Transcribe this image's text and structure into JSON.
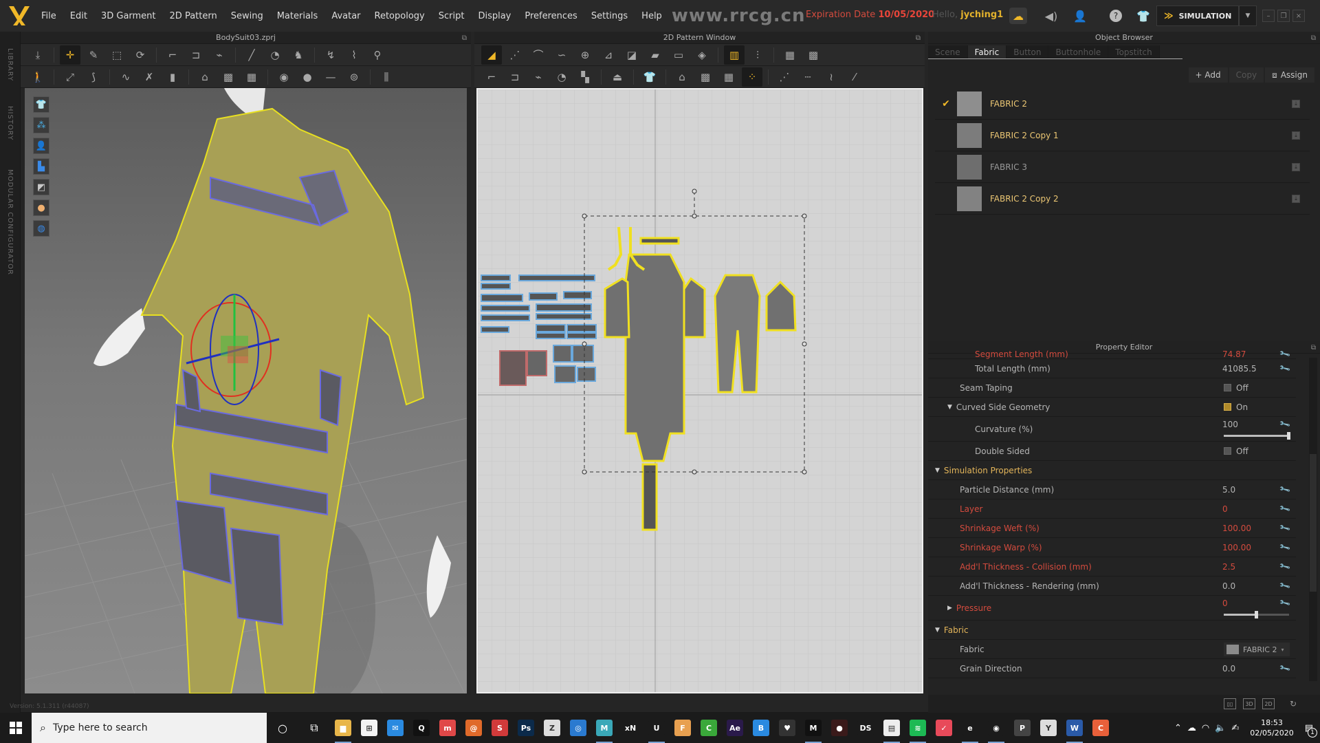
{
  "app": {
    "menu": [
      "File",
      "Edit",
      "3D Garment",
      "2D Pattern",
      "Sewing",
      "Materials",
      "Avatar",
      "Retopology",
      "Script",
      "Display",
      "Preferences",
      "Settings",
      "Help"
    ],
    "watermark_url": "www.rrcg.cn",
    "expiration_label": "Expiration Date",
    "expiration_date": "10/05/2020",
    "hello_label": "Hello,",
    "username": "jyching1",
    "mode_button": "SIMULATION",
    "accent_color": "#f0b828"
  },
  "side_tabs": [
    "LIBRARY",
    "HISTORY",
    "MODULAR CONFIGURATOR"
  ],
  "panel3d": {
    "title": "BodySuit03.zprj",
    "version": "Version: 5.1.311 (r44087)"
  },
  "panel2d": {
    "title": "2D Pattern Window"
  },
  "object_browser": {
    "title": "Object Browser",
    "tabs": [
      "Scene",
      "Fabric",
      "Button",
      "Buttonhole",
      "Topstitch"
    ],
    "active_tab": "Fabric",
    "actions": {
      "add": "+ Add",
      "copy": "Copy",
      "assign": "Assign"
    },
    "fabrics": [
      {
        "name": "FABRIC 2",
        "selected": true
      },
      {
        "name": "FABRIC 2 Copy 1",
        "selected": false
      },
      {
        "name": "FABRIC 3",
        "selected": false
      },
      {
        "name": "FABRIC 2 Copy 2",
        "selected": false
      }
    ]
  },
  "property_editor": {
    "title": "Property Editor",
    "rows": {
      "segment_length": {
        "label": "Segment Length (mm)",
        "value": "74.87"
      },
      "total_length": {
        "label": "Total Length (mm)",
        "value": "41085.5"
      },
      "seam_taping": {
        "label": "Seam Taping",
        "value": "Off"
      },
      "curved_side": {
        "label": "Curved Side Geometry",
        "value": "On"
      },
      "curvature": {
        "label": "Curvature (%)",
        "value": "100",
        "slider_percent": 100
      },
      "double_sided": {
        "label": "Double Sided",
        "value": "Off"
      },
      "sim_section": {
        "label": "Simulation Properties"
      },
      "particle_distance": {
        "label": "Particle Distance (mm)",
        "value": "5.0"
      },
      "layer": {
        "label": "Layer",
        "value": "0"
      },
      "shrinkage_weft": {
        "label": "Shrinkage Weft (%)",
        "value": "100.00"
      },
      "shrinkage_warp": {
        "label": "Shrinkage Warp (%)",
        "value": "100.00"
      },
      "thickness_collision": {
        "label": "Add'l Thickness - Collision (mm)",
        "value": "2.5"
      },
      "thickness_rendering": {
        "label": "Add'l Thickness - Rendering (mm)",
        "value": "0.0"
      },
      "pressure": {
        "label": "Pressure",
        "value": "0",
        "slider_percent": 50
      },
      "fabric_section": {
        "label": "Fabric"
      },
      "fabric": {
        "label": "Fabric",
        "value": "FABRIC 2"
      },
      "grain_direction": {
        "label": "Grain Direction",
        "value": "0.0"
      }
    },
    "view_modes": [
      "3D",
      "2D"
    ]
  },
  "taskbar": {
    "search_placeholder": "Type here to search",
    "time": "18:53",
    "date": "02/05/2020",
    "notification_count": "1",
    "apps": [
      {
        "name": "file-explorer",
        "glyph": "▆",
        "color": "#e8b64a"
      },
      {
        "name": "store",
        "glyph": "⊞",
        "color": "#f3f3f3"
      },
      {
        "name": "mail",
        "glyph": "✉",
        "color": "#2a8ae0"
      },
      {
        "name": "quixel",
        "glyph": "Q",
        "color": "#111"
      },
      {
        "name": "marvelous-red",
        "glyph": "m",
        "color": "#e04848"
      },
      {
        "name": "houdini",
        "glyph": "@",
        "color": "#e06a2a"
      },
      {
        "name": "substance",
        "glyph": "S",
        "color": "#d23a3a"
      },
      {
        "name": "photoshop",
        "glyph": "Ps",
        "color": "#0b2a4a"
      },
      {
        "name": "zbrush",
        "glyph": "Z",
        "color": "#ddd"
      },
      {
        "name": "browser",
        "glyph": "◎",
        "color": "#2a7ad0"
      },
      {
        "name": "maya",
        "glyph": "M",
        "color": "#3aa8b8"
      },
      {
        "name": "xnormal",
        "glyph": "xN",
        "color": "#1b1b1b"
      },
      {
        "name": "unreal",
        "glyph": "U",
        "color": "#1b1b1b"
      },
      {
        "name": "fusion",
        "glyph": "F",
        "color": "#e8a050"
      },
      {
        "name": "camtasia",
        "glyph": "C",
        "color": "#3aa83a"
      },
      {
        "name": "after-effects",
        "glyph": "Ae",
        "color": "#2a1a4a"
      },
      {
        "name": "app-b",
        "glyph": "B",
        "color": "#2a8ae0"
      },
      {
        "name": "heart-app",
        "glyph": "♥",
        "color": "#333"
      },
      {
        "name": "marvelous",
        "glyph": "M",
        "color": "#111"
      },
      {
        "name": "davinci",
        "glyph": "●",
        "color": "#3a1a1a"
      },
      {
        "name": "daz-studio",
        "glyph": "DS",
        "color": "#1b1b1b"
      },
      {
        "name": "reader",
        "glyph": "▤",
        "color": "#eee"
      },
      {
        "name": "spotify",
        "glyph": "≋",
        "color": "#1db954"
      },
      {
        "name": "clock-app",
        "glyph": "✓",
        "color": "#e84a5a"
      },
      {
        "name": "edge",
        "glyph": "e",
        "color": "#1b1b1b"
      },
      {
        "name": "chrome",
        "glyph": "◉",
        "color": "#1b1b1b"
      },
      {
        "name": "pr-app",
        "glyph": "P",
        "color": "#444"
      },
      {
        "name": "clock2",
        "glyph": "Y",
        "color": "#ddd"
      },
      {
        "name": "word",
        "glyph": "W",
        "color": "#2a5aa8"
      },
      {
        "name": "camtasia-rec",
        "glyph": "C",
        "color": "#e8603a"
      }
    ]
  }
}
